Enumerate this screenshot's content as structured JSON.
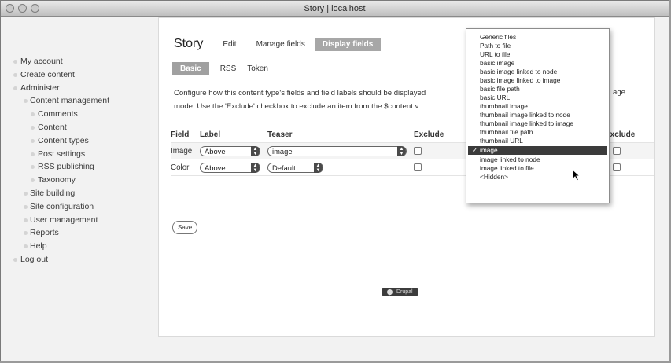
{
  "window": {
    "title": "Story | localhost"
  },
  "sidebar": {
    "items": [
      {
        "label": "My account"
      },
      {
        "label": "Create content"
      },
      {
        "label": "Administer"
      },
      {
        "label": "Content management"
      },
      {
        "label": "Comments"
      },
      {
        "label": "Content"
      },
      {
        "label": "Content types"
      },
      {
        "label": "Post settings"
      },
      {
        "label": "RSS publishing"
      },
      {
        "label": "Taxonomy"
      },
      {
        "label": "Site building"
      },
      {
        "label": "Site configuration"
      },
      {
        "label": "User management"
      },
      {
        "label": "Reports"
      },
      {
        "label": "Help"
      },
      {
        "label": "Log out"
      }
    ]
  },
  "main": {
    "title": "Story",
    "tabs": [
      {
        "label": "Edit"
      },
      {
        "label": "Manage fields"
      },
      {
        "label": "Display fields"
      }
    ],
    "subtabs": [
      {
        "label": "Basic"
      },
      {
        "label": "RSS"
      },
      {
        "label": "Token"
      }
    ],
    "description_line1": "Configure how this content type's fields and field labels should be displayed",
    "description_line2": "mode. Use the 'Exclude' checkbox to exclude an item from the $content v",
    "description_tail": "age",
    "table": {
      "headers": {
        "field": "Field",
        "label": "Label",
        "teaser": "Teaser",
        "exclude": "Exclude",
        "exclude2": "Exclude"
      },
      "rows": [
        {
          "field": "Image",
          "label": "Above",
          "teaser": "image"
        },
        {
          "field": "Color",
          "label": "Above",
          "teaser": "Default"
        }
      ]
    },
    "save_label": "Save",
    "badge_label": "Drupal"
  },
  "dropdown": {
    "options": [
      "Generic files",
      "Path to file",
      "URL to file",
      "basic image",
      "basic image linked to node",
      "basic image linked to image",
      "basic file path",
      "basic URL",
      "thumbnail image",
      "thumbnail image linked to node",
      "thumbnail image linked to image",
      "thumbnail file path",
      "thumbnail URL",
      "image",
      "image linked to node",
      "image linked to file",
      "<Hidden>"
    ],
    "selected": "image",
    "check_glyph": "✓"
  }
}
